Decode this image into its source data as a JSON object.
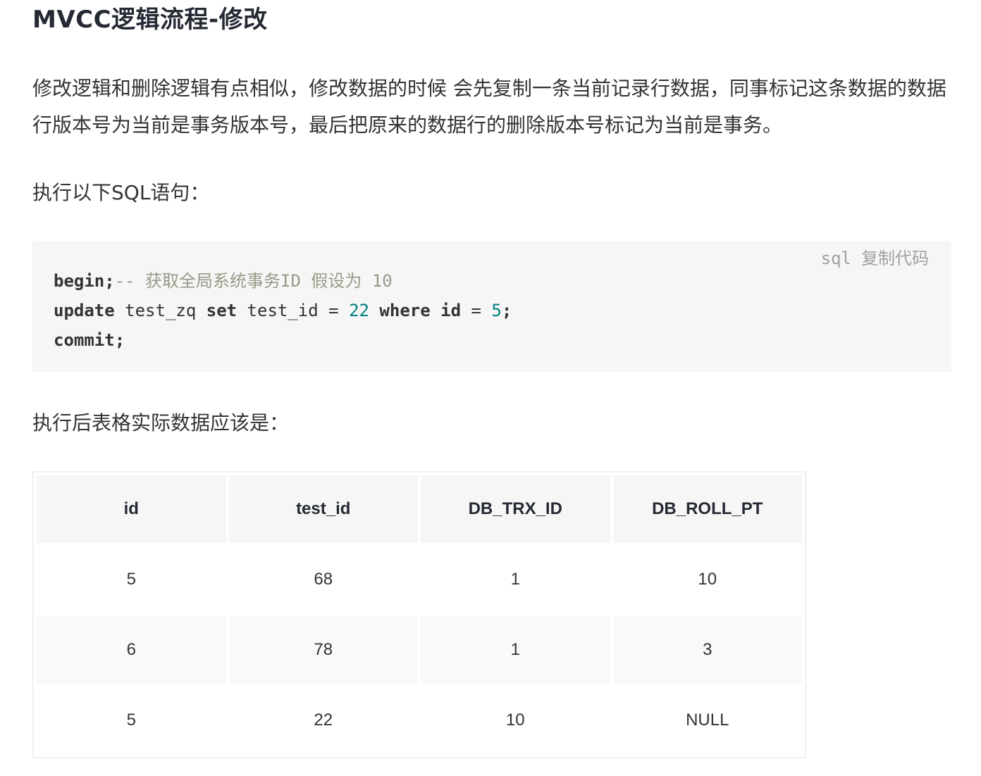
{
  "heading": "MVCC逻辑流程-修改",
  "paragraphs": {
    "intro": "修改逻辑和删除逻辑有点相似，修改数据的时候 会先复制一条当前记录行数据，同事标记这条数据的数据行版本号为当前是事务版本号，最后把原来的数据行的删除版本号标记为当前是事务。",
    "run_sql": "执行以下SQL语句：",
    "after": "执行后表格实际数据应该是："
  },
  "code": {
    "language": "sql",
    "copy_label": "复制代码",
    "line1_kw": "begin;",
    "line1_comment": "-- 获取全局系统事务ID 假设为 10",
    "line2_kw_update": "update",
    "line2_table": " test_zq ",
    "line2_kw_set": "set",
    "line2_col": " test_id = ",
    "line2_val": "22",
    "line2_kw_where": " where id",
    "line2_eq": " = ",
    "line2_val2": "5",
    "line2_end": ";",
    "line3_kw": "commit;"
  },
  "table": {
    "headers": [
      "id",
      "test_id",
      "DB_TRX_ID",
      "DB_ROLL_PT"
    ],
    "rows": [
      [
        "5",
        "68",
        "1",
        "10"
      ],
      [
        "6",
        "78",
        "1",
        "3"
      ],
      [
        "5",
        "22",
        "10",
        "NULL"
      ]
    ]
  }
}
